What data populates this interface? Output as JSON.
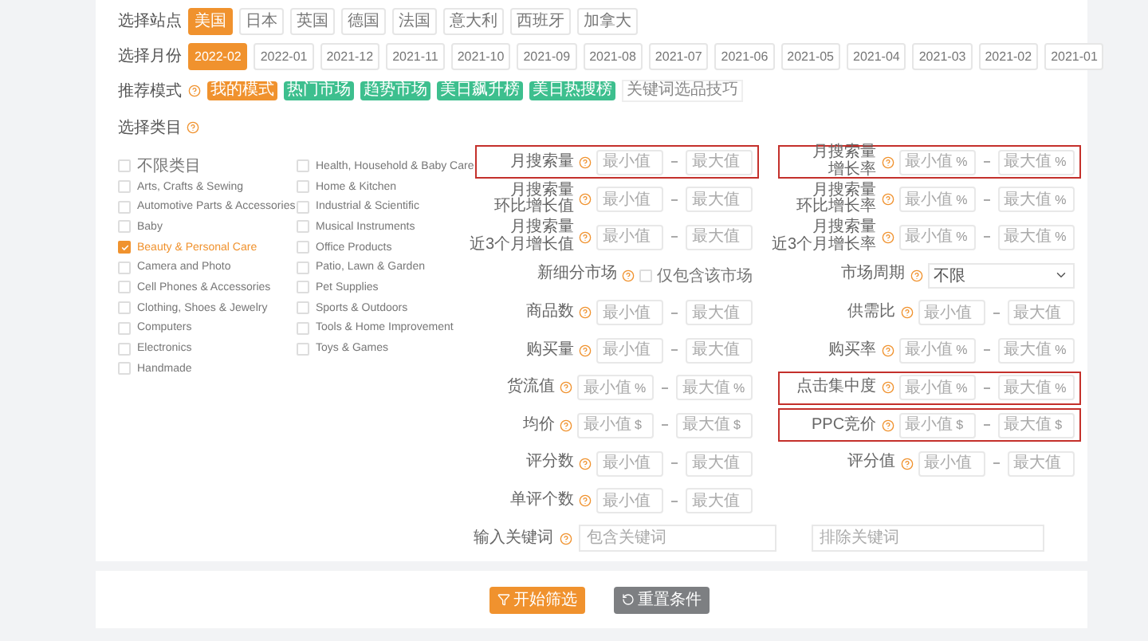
{
  "site_selector": {
    "label": "选择站点",
    "options": [
      {
        "label": "美国",
        "selected": true
      },
      {
        "label": "日本",
        "selected": false
      },
      {
        "label": "英国",
        "selected": false
      },
      {
        "label": "德国",
        "selected": false
      },
      {
        "label": "法国",
        "selected": false
      },
      {
        "label": "意大利",
        "selected": false
      },
      {
        "label": "西班牙",
        "selected": false
      },
      {
        "label": "加拿大",
        "selected": false
      }
    ]
  },
  "month_selector": {
    "label": "选择月份",
    "options": [
      {
        "label": "2022-02",
        "selected": true
      },
      {
        "label": "2022-01",
        "selected": false
      },
      {
        "label": "2021-12",
        "selected": false
      },
      {
        "label": "2021-11",
        "selected": false
      },
      {
        "label": "2021-10",
        "selected": false
      },
      {
        "label": "2021-09",
        "selected": false
      },
      {
        "label": "2021-08",
        "selected": false
      },
      {
        "label": "2021-07",
        "selected": false
      },
      {
        "label": "2021-06",
        "selected": false
      },
      {
        "label": "2021-05",
        "selected": false
      },
      {
        "label": "2021-04",
        "selected": false
      },
      {
        "label": "2021-03",
        "selected": false
      },
      {
        "label": "2021-02",
        "selected": false
      },
      {
        "label": "2021-01",
        "selected": false
      }
    ]
  },
  "recommend_mode": {
    "label": "推荐模式",
    "tags": [
      {
        "label": "我的模式",
        "kind": "tag",
        "color": "#f0922e"
      },
      {
        "label": "热门市场",
        "kind": "tag",
        "color": "#3dbf8e"
      },
      {
        "label": "趋势市场",
        "kind": "tag",
        "color": "#3dbf8e"
      },
      {
        "label": "美日飙升榜",
        "kind": "tag",
        "color": "#3dbf8e"
      },
      {
        "label": "美日热搜榜",
        "kind": "tag",
        "color": "#3dbf8e"
      },
      {
        "label": "关键词选品技巧",
        "kind": "link"
      }
    ]
  },
  "category": {
    "label": "选择类目",
    "columns": [
      [
        {
          "label": "不限类目",
          "checked": false
        },
        {
          "label": "Arts, Crafts & Sewing",
          "checked": false
        },
        {
          "label": "Automotive Parts & Accessories",
          "checked": false
        },
        {
          "label": "Baby",
          "checked": false
        },
        {
          "label": "Beauty & Personal Care",
          "checked": true
        },
        {
          "label": "Camera and Photo",
          "checked": false
        },
        {
          "label": "Cell Phones & Accessories",
          "checked": false
        },
        {
          "label": "Clothing, Shoes & Jewelry",
          "checked": false
        },
        {
          "label": "Computers",
          "checked": false
        },
        {
          "label": "Electronics",
          "checked": false
        },
        {
          "label": "Handmade",
          "checked": false
        }
      ],
      [
        {
          "label": "Health, Household & Baby Care",
          "checked": false
        },
        {
          "label": "Home & Kitchen",
          "checked": false
        },
        {
          "label": "Industrial & Scientific",
          "checked": false
        },
        {
          "label": "Musical Instruments",
          "checked": false
        },
        {
          "label": "Office Products",
          "checked": false
        },
        {
          "label": "Patio, Lawn & Garden",
          "checked": false
        },
        {
          "label": "Pet Supplies",
          "checked": false
        },
        {
          "label": "Sports & Outdoors",
          "checked": false
        },
        {
          "label": "Tools & Home Improvement",
          "checked": false
        },
        {
          "label": "Toys & Games",
          "checked": false
        }
      ]
    ]
  },
  "filters": {
    "left": [
      {
        "label": [
          "月搜索量"
        ],
        "kind": "range",
        "highlighted": true,
        "min": {
          "placeholder": "最小值"
        },
        "max": {
          "placeholder": "最大值"
        }
      },
      {
        "label": [
          "月搜索量",
          "环比增长值"
        ],
        "kind": "range",
        "highlighted": false,
        "min": {
          "placeholder": "最小值"
        },
        "max": {
          "placeholder": "最大值"
        }
      },
      {
        "label": [
          "月搜索量",
          "近3个月增长值"
        ],
        "kind": "range",
        "highlighted": false,
        "min": {
          "placeholder": "最小值"
        },
        "max": {
          "placeholder": "最大值"
        }
      },
      {
        "label": [
          "新细分市场"
        ],
        "kind": "checkbox",
        "highlighted": false,
        "checked": false,
        "text": "仅包含该市场"
      },
      {
        "label": [
          "商品数"
        ],
        "kind": "range",
        "highlighted": false,
        "min": {
          "placeholder": "最小值"
        },
        "max": {
          "placeholder": "最大值"
        }
      },
      {
        "label": [
          "购买量"
        ],
        "kind": "range",
        "highlighted": false,
        "min": {
          "placeholder": "最小值"
        },
        "max": {
          "placeholder": "最大值"
        }
      },
      {
        "label": [
          "货流值"
        ],
        "kind": "range",
        "highlighted": false,
        "min": {
          "placeholder": "最小值",
          "unit": "%"
        },
        "max": {
          "placeholder": "最大值",
          "unit": "%"
        }
      },
      {
        "label": [
          "均价"
        ],
        "kind": "range",
        "highlighted": false,
        "min": {
          "placeholder": "最小值",
          "unit": "$"
        },
        "max": {
          "placeholder": "最大值",
          "unit": "$"
        }
      },
      {
        "label": [
          "评分数"
        ],
        "kind": "range",
        "highlighted": false,
        "min": {
          "placeholder": "最小值"
        },
        "max": {
          "placeholder": "最大值"
        }
      },
      {
        "label": [
          "单评个数"
        ],
        "kind": "range",
        "highlighted": false,
        "min": {
          "placeholder": "最小值"
        },
        "max": {
          "placeholder": "最大值"
        }
      }
    ],
    "right": [
      {
        "label": [
          "月搜索量",
          "增长率"
        ],
        "kind": "range",
        "highlighted": true,
        "min": {
          "placeholder": "最小值",
          "unit": "%"
        },
        "max": {
          "placeholder": "最大值",
          "unit": "%"
        }
      },
      {
        "label": [
          "月搜索量",
          "环比增长率"
        ],
        "kind": "range",
        "highlighted": false,
        "min": {
          "placeholder": "最小值",
          "unit": "%"
        },
        "max": {
          "placeholder": "最大值",
          "unit": "%"
        }
      },
      {
        "label": [
          "月搜索量",
          "近3个月增长率"
        ],
        "kind": "range",
        "highlighted": false,
        "min": {
          "placeholder": "最小值",
          "unit": "%"
        },
        "max": {
          "placeholder": "最大值",
          "unit": "%"
        }
      },
      {
        "label": [
          "市场周期"
        ],
        "kind": "select",
        "highlighted": false,
        "value": "不限"
      },
      {
        "label": [
          "供需比"
        ],
        "kind": "range",
        "highlighted": false,
        "min": {
          "placeholder": "最小值"
        },
        "max": {
          "placeholder": "最大值"
        }
      },
      {
        "label": [
          "购买率"
        ],
        "kind": "range",
        "highlighted": false,
        "min": {
          "placeholder": "最小值",
          "unit": "%"
        },
        "max": {
          "placeholder": "最大值",
          "unit": "%"
        }
      },
      {
        "label": [
          "点击集中度"
        ],
        "kind": "range",
        "highlighted": true,
        "min": {
          "placeholder": "最小值",
          "unit": "%"
        },
        "max": {
          "placeholder": "最大值",
          "unit": "%"
        }
      },
      {
        "label": [
          "PPC竞价"
        ],
        "kind": "range",
        "highlighted": true,
        "min": {
          "placeholder": "最小值",
          "unit": "$"
        },
        "max": {
          "placeholder": "最大值",
          "unit": "$"
        }
      },
      {
        "label": [
          "评分值"
        ],
        "kind": "range",
        "highlighted": false,
        "min": {
          "placeholder": "最小值"
        },
        "max": {
          "placeholder": "最大值"
        }
      }
    ]
  },
  "keywords": {
    "label": "输入关键词",
    "fields": [
      {
        "placeholder": "包含关键词"
      },
      {
        "placeholder": "排除关键词"
      }
    ]
  },
  "buttons": [
    {
      "label": "开始筛选",
      "kind": "primary"
    },
    {
      "label": "重置条件",
      "kind": "secondary"
    }
  ]
}
